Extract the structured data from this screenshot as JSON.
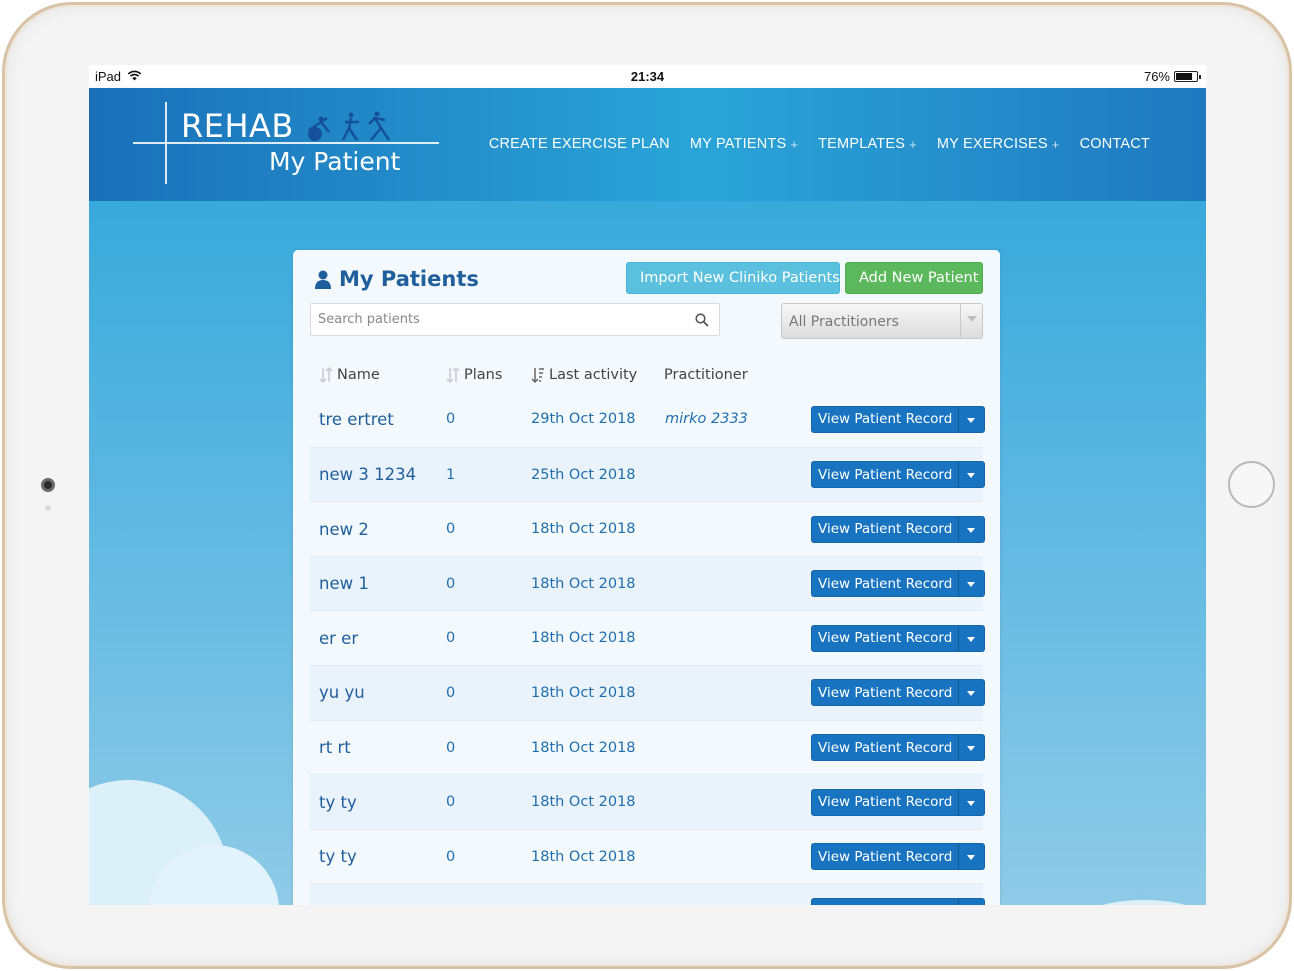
{
  "status_bar": {
    "device": "iPad",
    "time": "21:34",
    "battery": "76%"
  },
  "header": {
    "logo_line1": "REHAB",
    "logo_line2": "My Patient",
    "nav": [
      {
        "label": "CREATE EXERCISE PLAN",
        "has_plus": false
      },
      {
        "label": "MY PATIENTS",
        "has_plus": true
      },
      {
        "label": "TEMPLATES",
        "has_plus": true
      },
      {
        "label": "MY EXERCISES",
        "has_plus": true
      },
      {
        "label": "CONTACT",
        "has_plus": false
      }
    ],
    "plus_symbol": "+"
  },
  "panel": {
    "title": "My Patients",
    "import_button": "Import New Cliniko Patients",
    "add_button": "Add New Patient",
    "search_placeholder": "Search patients",
    "practitioner_filter": "All Practitioners"
  },
  "table": {
    "headers": {
      "name": "Name",
      "plans": "Plans",
      "last_activity": "Last activity",
      "practitioner": "Practitioner"
    },
    "action_label": "View Patient Record",
    "rows": [
      {
        "name": "tre ertret",
        "plans": "0",
        "last_activity": "29th Oct 2018",
        "practitioner": "mirko 2333"
      },
      {
        "name": "new 3 1234",
        "plans": "1",
        "last_activity": "25th Oct 2018",
        "practitioner": ""
      },
      {
        "name": "new 2",
        "plans": "0",
        "last_activity": "18th Oct 2018",
        "practitioner": ""
      },
      {
        "name": "new 1",
        "plans": "0",
        "last_activity": "18th Oct 2018",
        "practitioner": ""
      },
      {
        "name": "er er",
        "plans": "0",
        "last_activity": "18th Oct 2018",
        "practitioner": ""
      },
      {
        "name": "yu yu",
        "plans": "0",
        "last_activity": "18th Oct 2018",
        "practitioner": ""
      },
      {
        "name": "rt rt",
        "plans": "0",
        "last_activity": "18th Oct 2018",
        "practitioner": ""
      },
      {
        "name": "ty ty",
        "plans": "0",
        "last_activity": "18th Oct 2018",
        "practitioner": ""
      },
      {
        "name": "ty ty",
        "plans": "0",
        "last_activity": "18th Oct 2018",
        "practitioner": ""
      },
      {
        "name": "",
        "plans": "",
        "last_activity": "",
        "practitioner": ""
      }
    ]
  },
  "colors": {
    "header_blue": "#1a70b9",
    "primary_button": "#1874c0",
    "info_button": "#5bc0de",
    "success_button": "#5cb85c",
    "link_text": "#1f6fae"
  },
  "icons": {
    "wifi": "wifi-icon",
    "battery": "battery-icon",
    "user": "user-icon",
    "import": "download-icon",
    "add": "plus-icon",
    "search": "search-icon",
    "sort": "sort-icon",
    "dropdown": "caret-down-icon"
  }
}
